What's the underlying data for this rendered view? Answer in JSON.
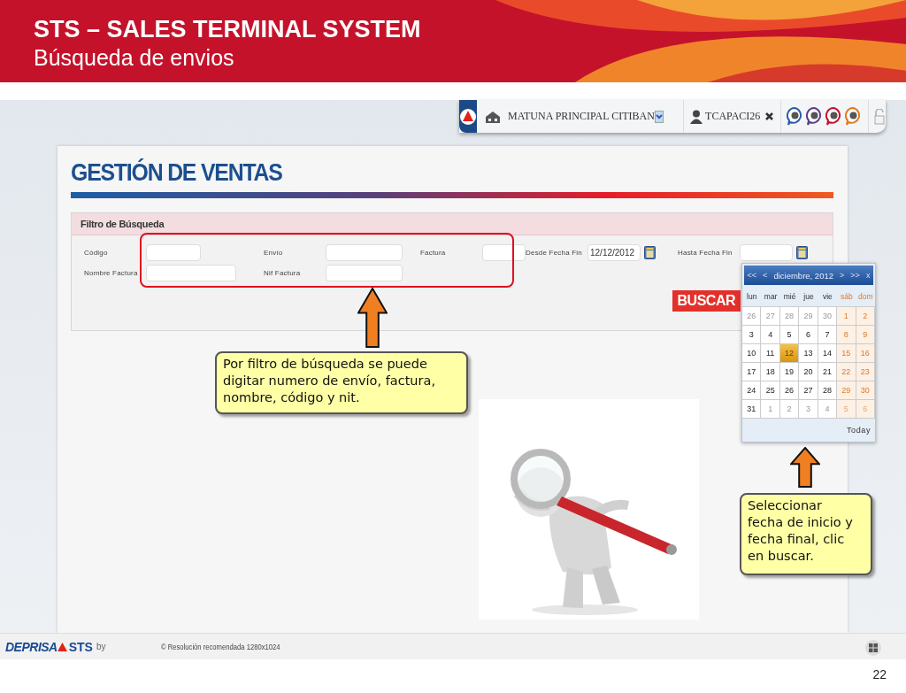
{
  "slide": {
    "title": "STS – SALES TERMINAL SYSTEM",
    "subtitle": "Búsqueda de envios",
    "page_number": "22"
  },
  "toolbar": {
    "branch": "MATUNA PRINCIPAL CITIBAN",
    "user": "TCAPACI26"
  },
  "app": {
    "heading": "GESTIÓN DE VENTAS",
    "filter_title": "Filtro de Búsqueda",
    "rows": [
      [
        {
          "label": "Código",
          "kind": "text"
        },
        {
          "label": "Envío",
          "kind": "text"
        },
        {
          "label": "Factura",
          "kind": "text"
        },
        {
          "label": "Desde Fecha Fin",
          "kind": "date",
          "value": "12/12/2012"
        },
        {
          "label": "Hasta Fecha Fin",
          "kind": "date"
        }
      ],
      [
        {
          "label": "Nombre Factura",
          "kind": "wide"
        },
        {
          "label": "Nif Factura",
          "kind": "text"
        }
      ]
    ],
    "search_button": "BUSCAR"
  },
  "calendar": {
    "nav": [
      {
        "text": "<<",
        "kind": "nav"
      },
      {
        "text": "<",
        "kind": "nav"
      },
      {
        "text": "diciembre, 2012",
        "kind": "title"
      },
      {
        "text": ">",
        "kind": "nav"
      },
      {
        "text": ">>",
        "kind": "nav"
      },
      {
        "text": "x",
        "kind": "close"
      }
    ],
    "weekdays": [
      {
        "text": "lun",
        "weekend": false
      },
      {
        "text": "mar",
        "weekend": false
      },
      {
        "text": "mié",
        "weekend": false
      },
      {
        "text": "jue",
        "weekend": false
      },
      {
        "text": "vie",
        "weekend": false
      },
      {
        "text": "sáb",
        "weekend": true
      },
      {
        "text": "dom",
        "weekend": true
      }
    ],
    "weeks": [
      [
        {
          "day": "26",
          "muted": true,
          "selected": false
        },
        {
          "day": "27",
          "muted": true,
          "selected": false
        },
        {
          "day": "28",
          "muted": true,
          "selected": false
        },
        {
          "day": "29",
          "muted": true,
          "selected": false
        },
        {
          "day": "30",
          "muted": true,
          "selected": false
        },
        {
          "day": "1",
          "muted": false,
          "selected": false
        },
        {
          "day": "2",
          "muted": false,
          "selected": false
        }
      ],
      [
        {
          "day": "3",
          "muted": false,
          "selected": false
        },
        {
          "day": "4",
          "muted": false,
          "selected": false
        },
        {
          "day": "5",
          "muted": false,
          "selected": false
        },
        {
          "day": "6",
          "muted": false,
          "selected": false
        },
        {
          "day": "7",
          "muted": false,
          "selected": false
        },
        {
          "day": "8",
          "muted": false,
          "selected": false
        },
        {
          "day": "9",
          "muted": false,
          "selected": false
        }
      ],
      [
        {
          "day": "10",
          "muted": false,
          "selected": false
        },
        {
          "day": "11",
          "muted": false,
          "selected": false
        },
        {
          "day": "12",
          "muted": false,
          "selected": true
        },
        {
          "day": "13",
          "muted": false,
          "selected": false
        },
        {
          "day": "14",
          "muted": false,
          "selected": false
        },
        {
          "day": "15",
          "muted": false,
          "selected": false
        },
        {
          "day": "16",
          "muted": false,
          "selected": false
        }
      ],
      [
        {
          "day": "17",
          "muted": false,
          "selected": false
        },
        {
          "day": "18",
          "muted": false,
          "selected": false
        },
        {
          "day": "19",
          "muted": false,
          "selected": false
        },
        {
          "day": "20",
          "muted": false,
          "selected": false
        },
        {
          "day": "21",
          "muted": false,
          "selected": false
        },
        {
          "day": "22",
          "muted": false,
          "selected": false
        },
        {
          "day": "23",
          "muted": false,
          "selected": false
        }
      ],
      [
        {
          "day": "24",
          "muted": false,
          "selected": false
        },
        {
          "day": "25",
          "muted": false,
          "selected": false
        },
        {
          "day": "26",
          "muted": false,
          "selected": false
        },
        {
          "day": "27",
          "muted": false,
          "selected": false
        },
        {
          "day": "28",
          "muted": false,
          "selected": false
        },
        {
          "day": "29",
          "muted": false,
          "selected": false
        },
        {
          "day": "30",
          "muted": false,
          "selected": false
        }
      ],
      [
        {
          "day": "31",
          "muted": false,
          "selected": false
        },
        {
          "day": "1",
          "muted": true,
          "selected": false
        },
        {
          "day": "2",
          "muted": true,
          "selected": false
        },
        {
          "day": "3",
          "muted": true,
          "selected": false
        },
        {
          "day": "4",
          "muted": true,
          "selected": false
        },
        {
          "day": "5",
          "muted": true,
          "selected": false
        },
        {
          "day": "6",
          "muted": true,
          "selected": false
        }
      ]
    ],
    "today": "Today"
  },
  "callouts": [
    "Por filtro de búsqueda se puede digitar numero de envío, factura, nombre, código y nit.",
    "Seleccionar fecha de inicio y fecha final, clic en buscar."
  ],
  "footer": {
    "logo_brand": "DEPRISA",
    "logo_product": "STS",
    "logo_by": "by",
    "note": "© Resolución recomendada 1280x1024"
  }
}
